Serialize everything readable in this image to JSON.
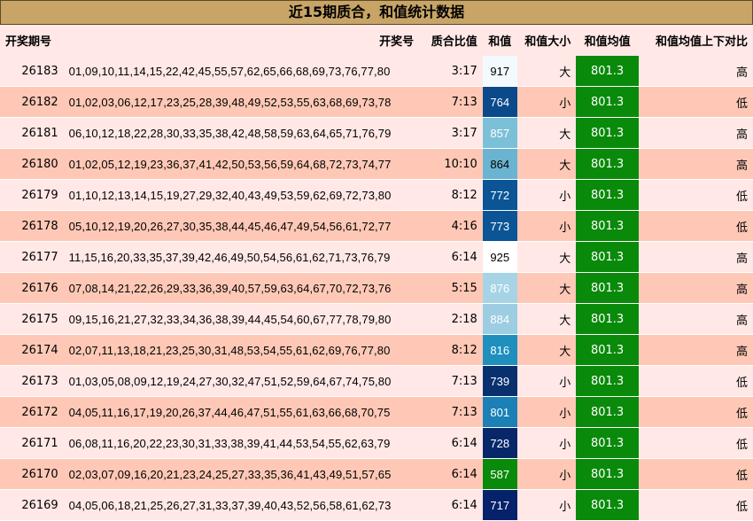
{
  "title": "近15期质合，和值统计数据",
  "headers": {
    "issue": "开奖期号",
    "nums": "开奖号",
    "ratio": "质合比值",
    "sum": "和值",
    "size": "和值大小",
    "avg": "和值均值",
    "cmp": "和值均值上下对比"
  },
  "rows": [
    {
      "issue": "26183",
      "nums": "01,09,10,11,14,15,22,42,45,55,57,62,65,66,68,69,73,76,77,80",
      "ratio": "3:17",
      "sum": "917",
      "size": "大",
      "avg": "801.3",
      "cmp": "高",
      "sum_bg": "#f3fafd",
      "sum_fg": "#000000"
    },
    {
      "issue": "26182",
      "nums": "01,02,03,06,12,17,23,25,28,39,48,49,52,53,55,63,68,69,73,78",
      "ratio": "7:13",
      "sum": "764",
      "size": "小",
      "avg": "801.3",
      "cmp": "低",
      "sum_bg": "#0a4a8a",
      "sum_fg": "#ffffff"
    },
    {
      "issue": "26181",
      "nums": "06,10,12,18,22,28,30,33,35,38,42,48,58,59,63,64,65,71,76,79",
      "ratio": "3:17",
      "sum": "857",
      "size": "大",
      "avg": "801.3",
      "cmp": "高",
      "sum_bg": "#7cc0d8",
      "sum_fg": "#ffffff"
    },
    {
      "issue": "26180",
      "nums": "01,02,05,12,19,23,36,37,41,42,50,53,56,59,64,68,72,73,74,77",
      "ratio": "10:10",
      "sum": "864",
      "size": "大",
      "avg": "801.3",
      "cmp": "高",
      "sum_bg": "#6ab4d2",
      "sum_fg": "#000000"
    },
    {
      "issue": "26179",
      "nums": "01,10,12,13,14,15,19,27,29,32,40,43,49,53,59,62,69,72,73,80",
      "ratio": "8:12",
      "sum": "772",
      "size": "小",
      "avg": "801.3",
      "cmp": "低",
      "sum_bg": "#0b5496",
      "sum_fg": "#ffffff"
    },
    {
      "issue": "26178",
      "nums": "05,10,12,19,20,26,27,30,35,38,44,45,46,47,49,54,56,61,72,77",
      "ratio": "4:16",
      "sum": "773",
      "size": "小",
      "avg": "801.3",
      "cmp": "低",
      "sum_bg": "#0b5496",
      "sum_fg": "#ffffff"
    },
    {
      "issue": "26177",
      "nums": "11,15,16,20,33,35,37,39,42,46,49,50,54,56,61,62,71,73,76,79",
      "ratio": "6:14",
      "sum": "925",
      "size": "大",
      "avg": "801.3",
      "cmp": "高",
      "sum_bg": "#ffffff",
      "sum_fg": "#000000"
    },
    {
      "issue": "26176",
      "nums": "07,08,14,21,22,26,29,33,36,39,40,57,59,63,64,67,70,72,73,76",
      "ratio": "5:15",
      "sum": "876",
      "size": "大",
      "avg": "801.3",
      "cmp": "高",
      "sum_bg": "#a6d4e6",
      "sum_fg": "#ffffff"
    },
    {
      "issue": "26175",
      "nums": "09,15,16,21,27,32,33,34,36,38,39,44,45,54,60,67,77,78,79,80",
      "ratio": "2:18",
      "sum": "884",
      "size": "大",
      "avg": "801.3",
      "cmp": "高",
      "sum_bg": "#9ccde2",
      "sum_fg": "#ffffff"
    },
    {
      "issue": "26174",
      "nums": "02,07,11,13,18,21,23,25,30,31,48,53,54,55,61,62,69,76,77,80",
      "ratio": "8:12",
      "sum": "816",
      "size": "大",
      "avg": "801.3",
      "cmp": "高",
      "sum_bg": "#1f8fbe",
      "sum_fg": "#ffffff"
    },
    {
      "issue": "26173",
      "nums": "01,03,05,08,09,12,19,24,27,30,32,47,51,52,59,64,67,74,75,80",
      "ratio": "7:13",
      "sum": "739",
      "size": "小",
      "avg": "801.3",
      "cmp": "低",
      "sum_bg": "#082f6e",
      "sum_fg": "#ffffff"
    },
    {
      "issue": "26172",
      "nums": "04,05,11,16,17,19,20,26,37,44,46,47,51,55,61,63,66,68,70,75",
      "ratio": "7:13",
      "sum": "801",
      "size": "小",
      "avg": "801.3",
      "cmp": "低",
      "sum_bg": "#1a80b6",
      "sum_fg": "#ffffff"
    },
    {
      "issue": "26171",
      "nums": "06,08,11,16,20,22,23,30,31,33,38,39,41,44,53,54,55,62,63,79",
      "ratio": "6:14",
      "sum": "728",
      "size": "小",
      "avg": "801.3",
      "cmp": "低",
      "sum_bg": "#07276a",
      "sum_fg": "#ffffff"
    },
    {
      "issue": "26170",
      "nums": "02,03,07,09,16,20,21,23,24,25,27,33,35,36,41,43,49,51,57,65",
      "ratio": "6:14",
      "sum": "587",
      "size": "小",
      "avg": "801.3",
      "cmp": "低",
      "sum_bg": "#0a8a0a",
      "sum_fg": "#ffffff"
    },
    {
      "issue": "26169",
      "nums": "04,05,06,18,21,25,26,27,31,33,37,39,40,43,52,56,58,61,62,73",
      "ratio": "6:14",
      "sum": "717",
      "size": "小",
      "avg": "801.3",
      "cmp": "低",
      "sum_bg": "#06226a",
      "sum_fg": "#ffffff"
    }
  ]
}
